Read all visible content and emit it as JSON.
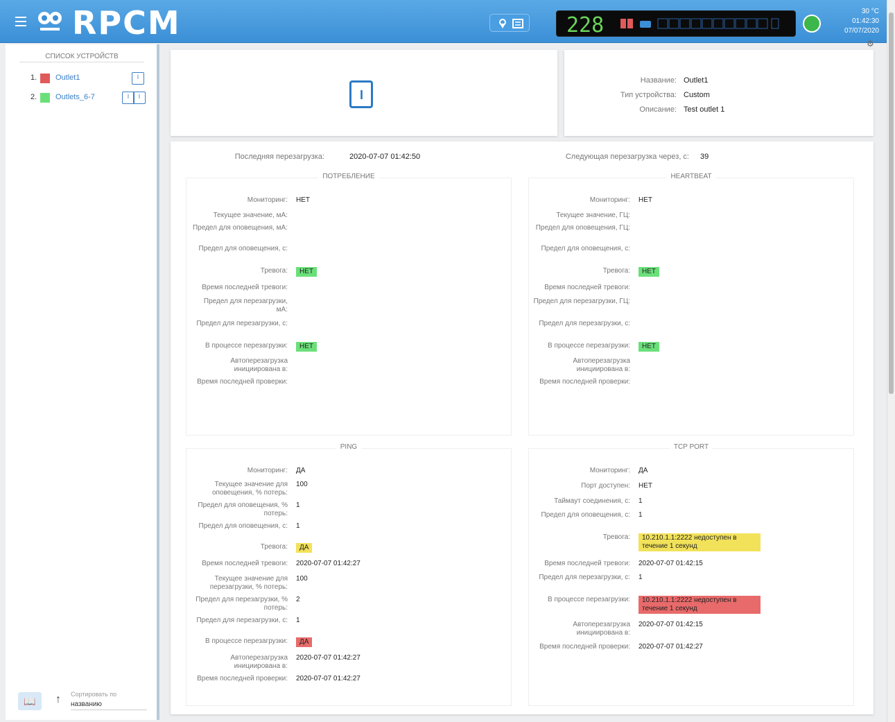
{
  "header": {
    "logo": "RPCM",
    "display_voltage": "228",
    "info": [
      "30 °C",
      "01:42:30",
      "07/07/2020"
    ]
  },
  "sidebar": {
    "title": "Список устройств",
    "devices": [
      {
        "num": "1.",
        "color": "#e05a5a",
        "name": "Outlet1"
      },
      {
        "num": "2.",
        "color": "#6be07a",
        "name": "Outlets_6-7"
      }
    ],
    "sort_label": "Сортировать по",
    "sort_value": "названию"
  },
  "device": {
    "rows": [
      {
        "label": "Название:",
        "value": "Outlet1"
      },
      {
        "label": "Тип устройства:",
        "value": "Custom"
      },
      {
        "label": "Описание:",
        "value": "Test outlet 1"
      }
    ]
  },
  "main": {
    "last_reboot_label": "Последняя перезагрузка:",
    "last_reboot_value": "2020-07-07 01:42:50",
    "next_reboot_label": "Следующая перезагрузка через, с:",
    "next_reboot_value": "39",
    "sections": {
      "consumption": {
        "title": "Потребление",
        "rows": [
          {
            "k": "Мониторинг:",
            "v": "НЕТ"
          },
          {
            "k": "Текущее значение, мА:",
            "v": ""
          },
          {
            "k": "Предел для оповещения, мА:",
            "v": ""
          },
          {
            "k": "Предел для оповещения, с:",
            "v": ""
          },
          {
            "k": "Тревога:",
            "v": "НЕТ",
            "badge": "g"
          },
          {
            "k": "Время последней тревоги:",
            "v": ""
          },
          {
            "k": "Предел для перезагрузки, мА:",
            "v": ""
          },
          {
            "k": "Предел для перезагрузки, с:",
            "v": ""
          },
          {
            "k": "В процессе перезагрузки:",
            "v": "НЕТ",
            "badge": "g"
          },
          {
            "k": "Автоперезагрузка инициирована в:",
            "v": ""
          },
          {
            "k": "Время последней проверки:",
            "v": ""
          }
        ]
      },
      "heartbeat": {
        "title": "Heartbeat",
        "rows": [
          {
            "k": "Мониторинг:",
            "v": "НЕТ"
          },
          {
            "k": "Текущее значение, ГЦ:",
            "v": ""
          },
          {
            "k": "Предел для оповещения, ГЦ:",
            "v": ""
          },
          {
            "k": "Предел для оповещения, с:",
            "v": ""
          },
          {
            "k": "Тревога:",
            "v": "НЕТ",
            "badge": "g"
          },
          {
            "k": "Время последней тревоги:",
            "v": ""
          },
          {
            "k": "Предел для перезагрузки, ГЦ:",
            "v": ""
          },
          {
            "k": "Предел для перезагрузки, с:",
            "v": ""
          },
          {
            "k": "В процессе перезагрузки:",
            "v": "НЕТ",
            "badge": "g"
          },
          {
            "k": "Автоперезагрузка инициирована в:",
            "v": ""
          },
          {
            "k": "Время последней проверки:",
            "v": ""
          }
        ]
      },
      "ping": {
        "title": "Ping",
        "rows": [
          {
            "k": "Мониторинг:",
            "v": "ДА"
          },
          {
            "k": "Текущее значение для оповещения, % потерь:",
            "v": "100"
          },
          {
            "k": "Предел для оповещения, % потерь:",
            "v": "1"
          },
          {
            "k": "Предел для оповещения, с:",
            "v": "1"
          },
          {
            "k": "Тревога:",
            "v": "ДА",
            "badge": "y"
          },
          {
            "k": "Время последней тревоги:",
            "v": "2020-07-07 01:42:27"
          },
          {
            "k": "Текущее значение для перезагрузки, % потерь:",
            "v": "100"
          },
          {
            "k": "Предел для перезагрузки, % потерь:",
            "v": "2"
          },
          {
            "k": "Предел для перезагрузки, с:",
            "v": "1"
          },
          {
            "k": "В процессе перезагрузки:",
            "v": "ДА",
            "badge": "r"
          },
          {
            "k": "Автоперезагрузка инициирована в:",
            "v": "2020-07-07 01:42:27"
          },
          {
            "k": "Время последней проверки:",
            "v": "2020-07-07 01:42:27"
          }
        ]
      },
      "tcp": {
        "title": "TCP port",
        "rows": [
          {
            "k": "Мониторинг:",
            "v": "ДА"
          },
          {
            "k": "Порт доступен:",
            "v": "НЕТ"
          },
          {
            "k": "Таймаут соединения, с:",
            "v": "1"
          },
          {
            "k": "Предел для оповещения, с:",
            "v": "1"
          },
          {
            "k": "Тревога:",
            "v": "10.210.1.1:2222 недоступен в течение 1 секунд",
            "badge": "y"
          },
          {
            "k": "Время последней тревоги:",
            "v": "2020-07-07 01:42:15"
          },
          {
            "k": "Предел для перезагрузки, с:",
            "v": "1"
          },
          {
            "k": "В процессе перезагрузки:",
            "v": "10.210.1.1:2222 недоступен в течение 1 секунд",
            "badge": "r"
          },
          {
            "k": "Автоперезагрузка инициирована в:",
            "v": "2020-07-07 01:42:15"
          },
          {
            "k": "Время последней проверки:",
            "v": "2020-07-07 01:42:27"
          }
        ]
      }
    }
  }
}
